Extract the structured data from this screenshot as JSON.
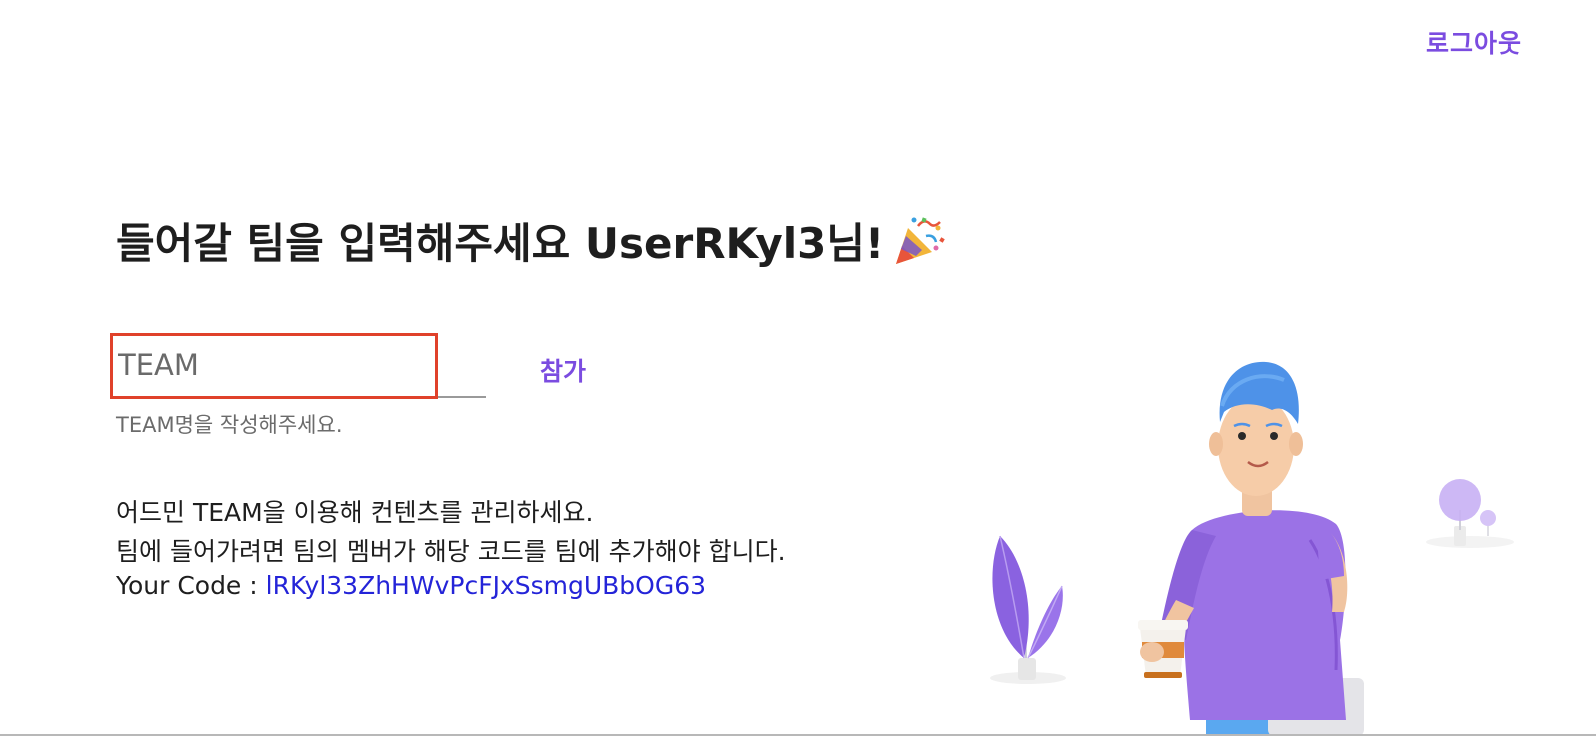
{
  "header": {
    "logout_label": "로그아웃"
  },
  "main": {
    "title": "들어갈 팀을 입력해주세요 UserRKyl3님!",
    "title_icon": "party-popper-icon",
    "team_input": {
      "placeholder": "TEAM",
      "value": ""
    },
    "join_label": "참가",
    "helper_text": "TEAM명을 작성해주세요.",
    "description": [
      "어드민 TEAM을 이용해 컨텐츠를 관리하세요.",
      "팀에 들어가려면 팀의 멤버가 해당 코드를 팀에 추가해야 합니다."
    ],
    "code_label": "Your Code : ",
    "code_value": "lRKyl33ZhHWvPcFJxSsmgUBbOG63"
  },
  "colors": {
    "accent": "#7b4ce0",
    "focus_border": "#e0412a",
    "code_link": "#2424d8"
  }
}
